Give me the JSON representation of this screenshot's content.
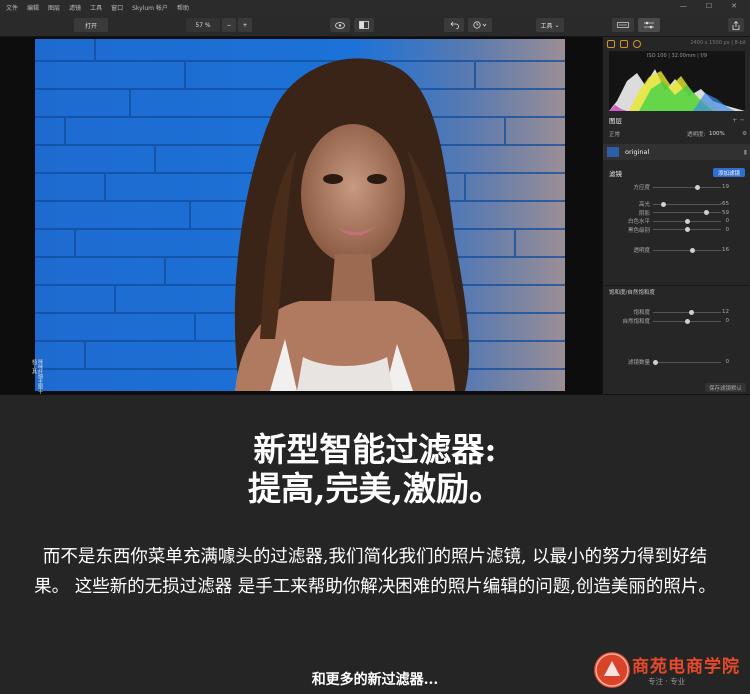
{
  "menubar": {
    "items": [
      "文件",
      "编辑",
      "图层",
      "滤镜",
      "工具",
      "窗口",
      "Skylum 帐户",
      "帮助"
    ],
    "minimize": "—",
    "maximize": "☐",
    "close": "✕"
  },
  "toolbar": {
    "open_label": "打开",
    "zoom": "57 %",
    "zoom_minus": "−",
    "zoom_plus": "+",
    "tools_label": "工具"
  },
  "photo": {
    "side_text": "咪咪纤细主图十档工具"
  },
  "panel": {
    "image_info": "2400 x 1500 px | 8-bit",
    "histogram_info": "ISO 100 | 32.00mm | f/9",
    "layers_title": "图层",
    "blend_mode": "正常",
    "opacity_label": "透明度:",
    "opacity_value": "100%",
    "layer_name": "original",
    "filters_title": "滤镜",
    "add_filter_button": "添加滤镜",
    "top_slider": {
      "label": "方应度",
      "value": "19"
    },
    "sliders": [
      {
        "label": "高光",
        "value": "-65",
        "pos": 0.15
      },
      {
        "label": "阴影",
        "value": "59",
        "pos": 0.78
      },
      {
        "label": "白色水平",
        "value": "0",
        "pos": 0.5
      },
      {
        "label": "黑色级别",
        "value": "0",
        "pos": 0.5
      },
      {
        "label": "透明度",
        "value": "16",
        "pos": 0.58
      }
    ],
    "subsection_title": "饱和度/自然饱和度",
    "sat_sliders": [
      {
        "label": "饱和度",
        "value": "12",
        "pos": 0.56
      },
      {
        "label": "自然饱和度",
        "value": "0",
        "pos": 0.5
      }
    ],
    "amount_label": "滤镜数量",
    "amount_value": "0",
    "save_default_button": "保存滤镜默认"
  },
  "caption": {
    "headline_line1": "新型智能过滤器:",
    "headline_line2": "提高,完美,激励。",
    "body": "而不是东西你菜单充满噱头的过滤器,我们简化我们的照片滤镜, 以最小的努力得到好结果。 这些新的无损过滤器 是手工来帮助你解决困难的照片编辑的问题,创造美丽的照片。",
    "more": "和更多的新过滤器..."
  },
  "watermark": {
    "name": "商苑电商学院",
    "tagline": "专注 · 专业"
  },
  "colors": {
    "accent_blue": "#2e6fd0",
    "panel_bg": "#262626",
    "logo_red": "#e64a2a"
  }
}
